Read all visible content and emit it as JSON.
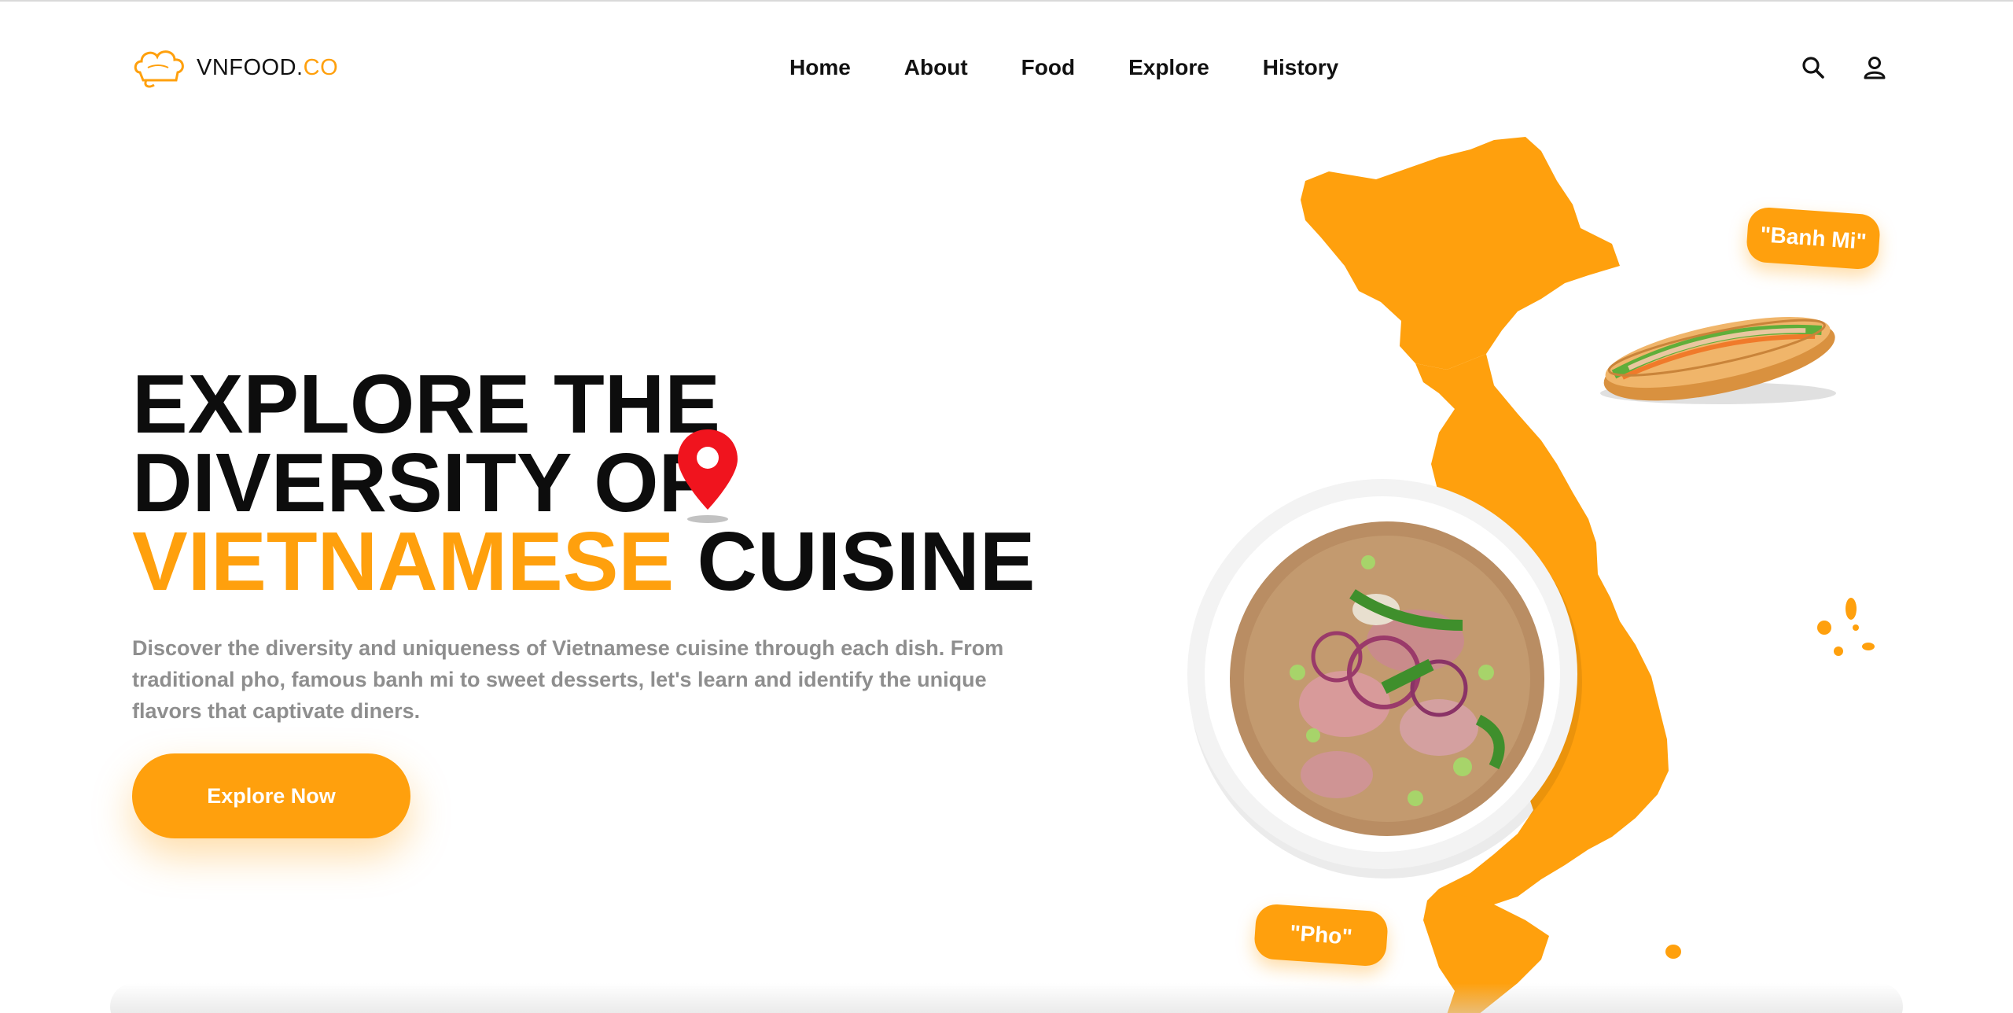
{
  "brand": {
    "name_main": "VNFOOD.",
    "name_accent": "CO",
    "accent_color": "#FFA00D",
    "icon": "chef-hat-icon"
  },
  "nav": {
    "items": [
      {
        "label": "Home"
      },
      {
        "label": "About"
      },
      {
        "label": "Food"
      },
      {
        "label": "Explore"
      },
      {
        "label": "History"
      }
    ]
  },
  "header_icons": [
    "search-icon",
    "user-icon"
  ],
  "hero": {
    "title_line1": "EXPLORE THE",
    "title_line2": "DIVERSITY OF",
    "title_line3_accent": "VIETNAMESE",
    "title_line3_rest": " CUISINE",
    "pin_icon": "location-pin-icon",
    "description": "Discover the diversity and uniqueness of Vietnamese cuisine through each dish. From traditional pho, famous banh mi to sweet desserts, let's learn and identify the unique flavors that captivate diners.",
    "cta_label": "Explore Now"
  },
  "illustration": {
    "map": "vietnam-map",
    "tags": [
      {
        "label": "\"Banh Mi\""
      },
      {
        "label": "\"Pho\""
      }
    ],
    "images": [
      "banh-mi-image",
      "pho-bowl-image"
    ]
  }
}
